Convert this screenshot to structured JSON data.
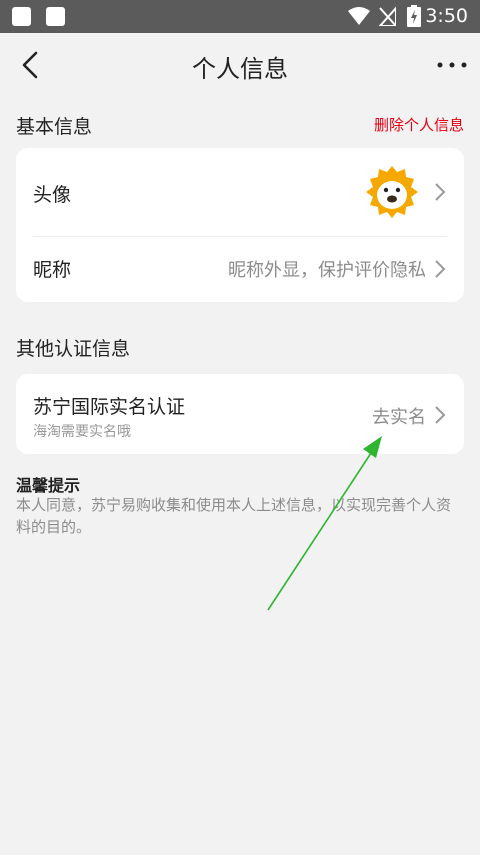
{
  "status_bar": {
    "time": "3:50"
  },
  "nav": {
    "title": "个人信息"
  },
  "basic": {
    "title": "基本信息",
    "delete_label": "删除个人信息",
    "avatar_label": "头像",
    "nickname_label": "昵称",
    "nickname_value": "昵称外显，保护评价隐私"
  },
  "other": {
    "title": "其他认证信息",
    "realname_title": "苏宁国际实名认证",
    "realname_sub": "海淘需要实名哦",
    "realname_action": "去实名"
  },
  "tip": {
    "title": "温馨提示",
    "body": "本人同意，苏宁易购收集和使用本人上述信息，以实现完善个人资料的目的。"
  },
  "colors": {
    "accent_red": "#e60012",
    "avatar_yellow": "#f5a800",
    "annotation_arrow": "#2fb52f"
  }
}
